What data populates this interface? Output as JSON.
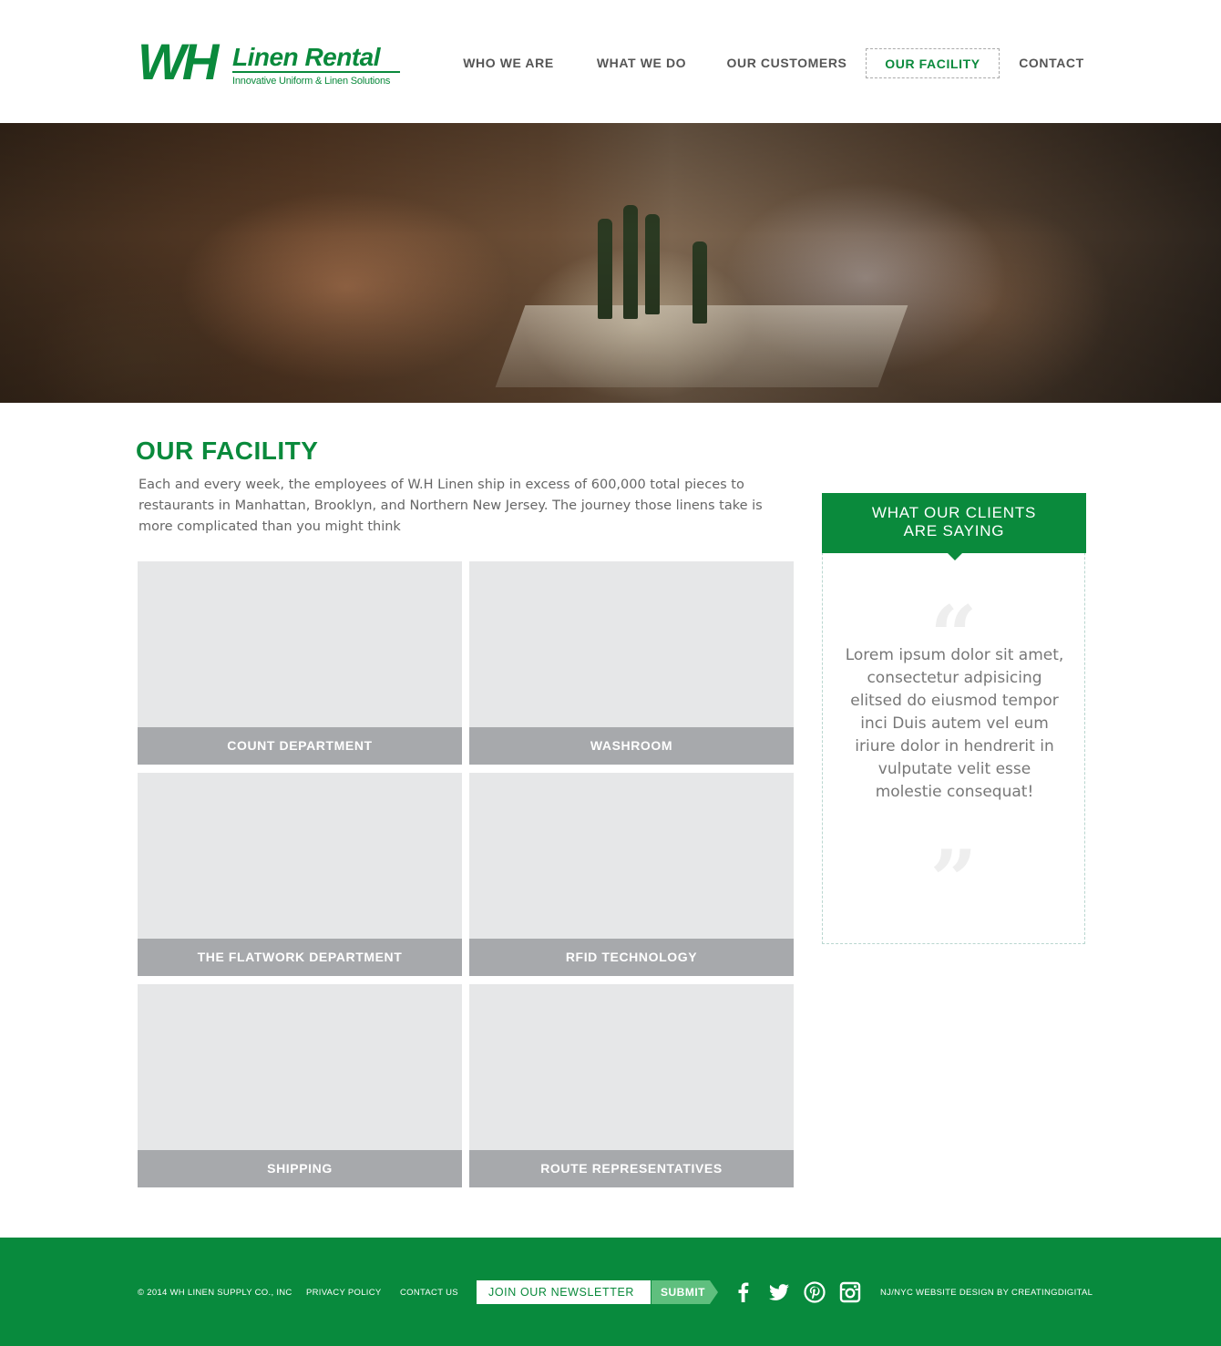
{
  "brand": {
    "logo_mark": "WH",
    "logo_name": "Linen Rental",
    "tagline": "Innovative Uniform & Linen Solutions",
    "accent_color": "#0a8a3c"
  },
  "nav": [
    {
      "label": "WHO WE ARE",
      "active": false
    },
    {
      "label": "WHAT WE DO",
      "active": false
    },
    {
      "label": "OUR CUSTOMERS",
      "active": false
    },
    {
      "label": "OUR FACILITY",
      "active": true
    },
    {
      "label": "CONTACT",
      "active": false
    }
  ],
  "page": {
    "title": "OUR FACILITY",
    "intro": "Each and every week, the employees of W.H Linen ship in excess of 600,000 total pieces to restaurants in Manhattan, Brooklyn, and Northern New Jersey. The journey those linens take is more complicated than you might think"
  },
  "tiles": [
    "COUNT DEPARTMENT",
    "WASHROOM",
    "THE FLATWORK DEPARTMENT",
    "RFID TECHNOLOGY",
    "SHIPPING",
    "ROUTE REPRESENTATIVES"
  ],
  "testimonial": {
    "heading_line1": "WHAT OUR CLIENTS",
    "heading_line2": "ARE SAYING",
    "quote": "Lorem ipsum dolor sit amet, consectetur adpisicing elitsed do eiusmod tempor inci Duis autem vel eum iriure dolor in hendrerit in vulputate velit esse molestie consequat!"
  },
  "footer": {
    "copyright": "© 2014 WH LINEN SUPPLY CO., INC",
    "privacy": "PRIVACY POLICY",
    "contact": "CONTACT US",
    "newsletter_placeholder": "JOIN OUR NEWSLETTER",
    "submit_label": "SUBMIT",
    "credit": "NJ/NYC WEBSITE DESIGN BY CREATINGDIGITAL",
    "social_icons": [
      "facebook-icon",
      "twitter-icon",
      "pinterest-icon",
      "instagram-icon"
    ],
    "bg_color": "#088a3d"
  }
}
